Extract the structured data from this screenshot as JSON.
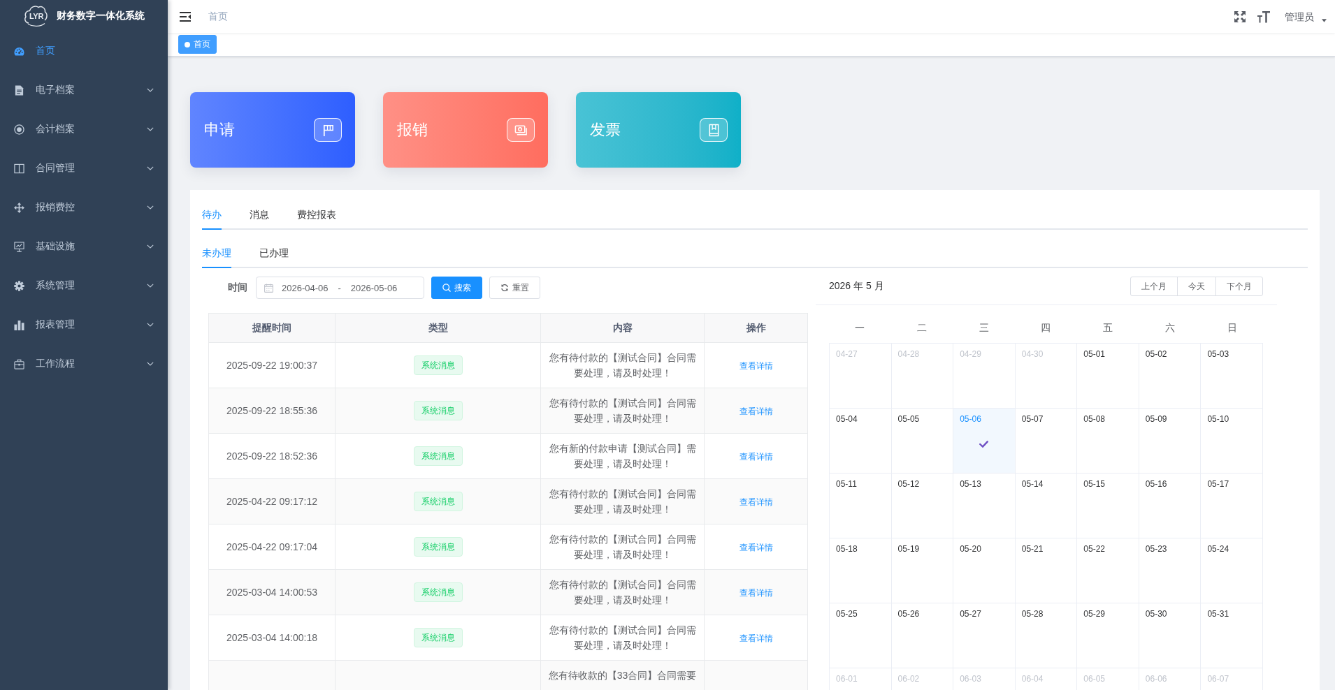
{
  "sidebar": {
    "logo_letters": "LYR",
    "title": "财务数字一体化系统",
    "items": [
      {
        "label": "首页",
        "kind": "dashboard",
        "selected": true
      },
      {
        "label": "电子档案",
        "kind": "document",
        "selected": false,
        "expanded": false
      },
      {
        "label": "会计档案",
        "kind": "coin",
        "selected": false,
        "expanded": false
      },
      {
        "label": "合同管理",
        "kind": "book",
        "selected": false,
        "expanded": false
      },
      {
        "label": "报销费控",
        "kind": "move",
        "selected": false,
        "expanded": false
      },
      {
        "label": "基础设施",
        "kind": "monitor",
        "selected": false,
        "expanded": false
      },
      {
        "label": "系统管理",
        "kind": "gear",
        "selected": false,
        "expanded": false
      },
      {
        "label": "报表管理",
        "kind": "chart",
        "selected": false,
        "expanded": false
      },
      {
        "label": "工作流程",
        "kind": "briefcase",
        "selected": false,
        "expanded": false
      }
    ]
  },
  "navbar": {
    "breadcrumb": "首页",
    "user": "管理员"
  },
  "tags": [
    {
      "label": "首页",
      "selected": true
    }
  ],
  "cards": [
    {
      "label": "申请",
      "kind": "flag",
      "color": "#2e5eff"
    },
    {
      "label": "报销",
      "kind": "cash",
      "color": "#ff6d5f"
    },
    {
      "label": "发票",
      "kind": "book",
      "color": "#0fb0c8"
    }
  ],
  "tabs": [
    {
      "label": "待办",
      "selected": true
    },
    {
      "label": "消息",
      "selected": false
    },
    {
      "label": "费控报表",
      "selected": false
    }
  ],
  "subtabs": [
    {
      "label": "未办理",
      "selected": true
    },
    {
      "label": "已办理",
      "selected": false
    }
  ],
  "filter": {
    "label": "时间",
    "start": "2026-04-06",
    "separator": "-",
    "end": "2026-05-06",
    "buttons": [
      {
        "label": "搜索",
        "kind": "search"
      },
      {
        "label": "重置",
        "kind": "reset"
      }
    ]
  },
  "table": {
    "columns": [
      "提醒时间",
      "类型",
      "内容",
      "操作"
    ],
    "rows": [
      {
        "time": "2025-09-22 19:00:37",
        "type": "系统消息",
        "content": "您有待付款的【测试合同】合同需要处理，请及时处理！",
        "action": "查看详情"
      },
      {
        "time": "2025-09-22 18:55:36",
        "type": "系统消息",
        "content": "您有待付款的【测试合同】合同需要处理，请及时处理！",
        "action": "查看详情"
      },
      {
        "time": "2025-09-22 18:52:36",
        "type": "系统消息",
        "content": "您有新的付款申请【测试合同】需要处理，请及时处理！",
        "action": "查看详情"
      },
      {
        "time": "2025-04-22 09:17:12",
        "type": "系统消息",
        "content": "您有待付款的【测试合同】合同需要处理，请及时处理！",
        "action": "查看详情"
      },
      {
        "time": "2025-04-22 09:17:04",
        "type": "系统消息",
        "content": "您有待付款的【测试合同】合同需要处理，请及时处理！",
        "action": "查看详情"
      },
      {
        "time": "2025-03-04 14:00:53",
        "type": "系统消息",
        "content": "您有待付款的【测试合同】合同需要处理，请及时处理！",
        "action": "查看详情"
      },
      {
        "time": "2025-03-04 14:00:18",
        "type": "系统消息",
        "content": "您有待付款的【测试合同】合同需要处理，请及时处理！",
        "action": "查看详情"
      },
      {
        "content": "您有待收款的【33合同】合同需要"
      }
    ]
  },
  "calendar": {
    "title": "2026 年 5 月",
    "buttons": [
      "上个月",
      "今天",
      "下个月"
    ],
    "weekdays": [
      "一",
      "二",
      "三",
      "四",
      "五",
      "六",
      "日"
    ],
    "days": [
      {
        "date": "04-27",
        "outside_month": true,
        "selected": false
      },
      {
        "date": "04-28",
        "outside_month": true,
        "selected": false
      },
      {
        "date": "04-29",
        "outside_month": true,
        "selected": false
      },
      {
        "date": "04-30",
        "outside_month": true,
        "selected": false
      },
      {
        "date": "05-01",
        "outside_month": false,
        "selected": false
      },
      {
        "date": "05-02",
        "outside_month": false,
        "selected": false
      },
      {
        "date": "05-03",
        "outside_month": false,
        "selected": false
      },
      {
        "date": "05-04",
        "outside_month": false,
        "selected": false
      },
      {
        "date": "05-05",
        "outside_month": false,
        "selected": false
      },
      {
        "date": "05-06",
        "outside_month": false,
        "selected": true
      },
      {
        "date": "05-07",
        "outside_month": false,
        "selected": false
      },
      {
        "date": "05-08",
        "outside_month": false,
        "selected": false
      },
      {
        "date": "05-09",
        "outside_month": false,
        "selected": false
      },
      {
        "date": "05-10",
        "outside_month": false,
        "selected": false
      },
      {
        "date": "05-11",
        "outside_month": false,
        "selected": false
      },
      {
        "date": "05-12",
        "outside_month": false,
        "selected": false
      },
      {
        "date": "05-13",
        "outside_month": false,
        "selected": false
      },
      {
        "date": "05-14",
        "outside_month": false,
        "selected": false
      },
      {
        "date": "05-15",
        "outside_month": false,
        "selected": false
      },
      {
        "date": "05-16",
        "outside_month": false,
        "selected": false
      },
      {
        "date": "05-17",
        "outside_month": false,
        "selected": false
      },
      {
        "date": "05-18",
        "outside_month": false,
        "selected": false
      },
      {
        "date": "05-19",
        "outside_month": false,
        "selected": false
      },
      {
        "date": "05-20",
        "outside_month": false,
        "selected": false
      },
      {
        "date": "05-21",
        "outside_month": false,
        "selected": false
      },
      {
        "date": "05-22",
        "outside_month": false,
        "selected": false
      },
      {
        "date": "05-23",
        "outside_month": false,
        "selected": false
      },
      {
        "date": "05-24",
        "outside_month": false,
        "selected": false
      },
      {
        "date": "05-25",
        "outside_month": false,
        "selected": false
      },
      {
        "date": "05-26",
        "outside_month": false,
        "selected": false
      },
      {
        "date": "05-27",
        "outside_month": false,
        "selected": false
      },
      {
        "date": "05-28",
        "outside_month": false,
        "selected": false
      },
      {
        "date": "05-29",
        "outside_month": false,
        "selected": false
      },
      {
        "date": "05-30",
        "outside_month": false,
        "selected": false
      },
      {
        "date": "05-31",
        "outside_month": false,
        "selected": false
      },
      {
        "date": "06-01",
        "outside_month": true,
        "selected": false
      },
      {
        "date": "06-02",
        "outside_month": true,
        "selected": false
      },
      {
        "date": "06-03",
        "outside_month": true,
        "selected": false
      },
      {
        "date": "06-04",
        "outside_month": true,
        "selected": false
      },
      {
        "date": "06-05",
        "outside_month": true,
        "selected": false
      },
      {
        "date": "06-06",
        "outside_month": true,
        "selected": false
      },
      {
        "date": "06-07",
        "outside_month": true,
        "selected": false
      }
    ]
  }
}
